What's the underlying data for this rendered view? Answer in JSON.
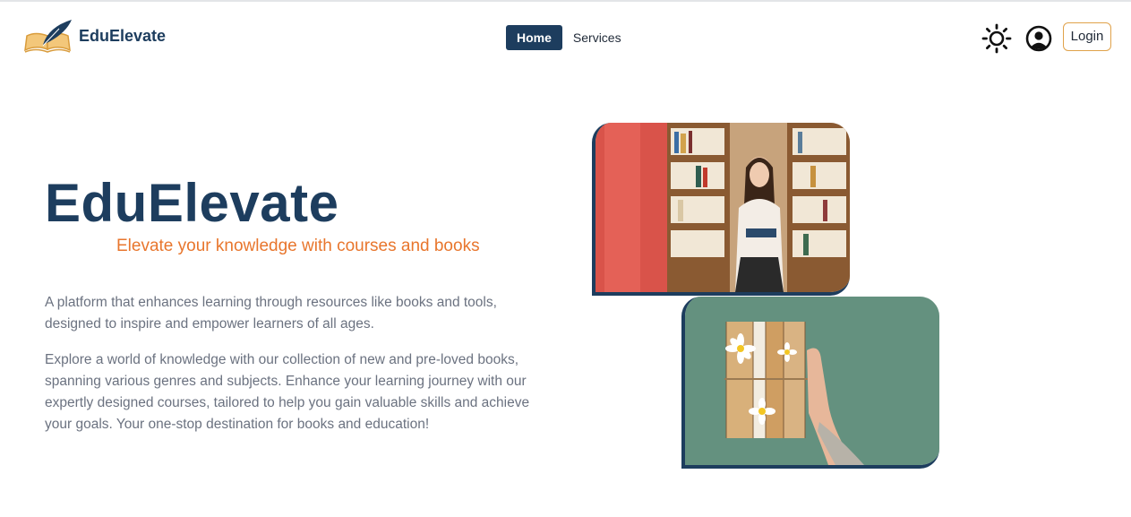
{
  "brand": {
    "name": "EduElevate"
  },
  "nav": {
    "home_label": "Home",
    "services_label": "Services"
  },
  "header": {
    "login_label": "Login",
    "theme_icon": "sun-icon",
    "account_icon": "user-circle-icon"
  },
  "hero": {
    "title": "EduElevate",
    "subtitle": "Elevate your knowledge with courses and books",
    "paragraph_1": "A platform that enhances learning through resources like books and tools, designed to inspire and empower learners of all ages.",
    "paragraph_2": "Explore a world of knowledge with our collection of new and pre-loved books, spanning various genres and subjects. Enhance your learning journey with our expertly designed courses, tailored to help you gain valuable skills and achieve your goals. Your one-stop destination for books and education!"
  },
  "colors": {
    "primary": "#1d3d5e",
    "accent": "#e8762d",
    "login_border": "#e0a24a",
    "text_muted": "#6b7280"
  }
}
